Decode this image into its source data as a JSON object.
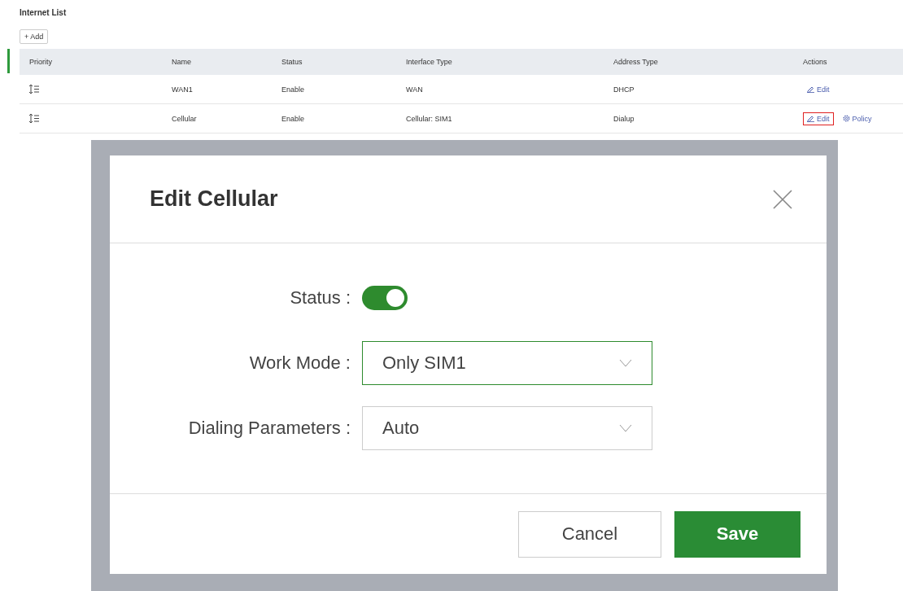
{
  "list": {
    "title": "Internet List",
    "add_button": "+ Add",
    "columns": [
      "Priority",
      "Name",
      "Status",
      "Interface Type",
      "Address Type",
      "Actions"
    ],
    "rows": [
      {
        "name": "WAN1",
        "status": "Enable",
        "interface_type": "WAN",
        "address_type": "DHCP",
        "actions": [
          {
            "kind": "edit",
            "label": "Edit",
            "highlighted": false
          }
        ]
      },
      {
        "name": "Cellular",
        "status": "Enable",
        "interface_type": "Cellular: SIM1",
        "address_type": "Dialup",
        "actions": [
          {
            "kind": "edit",
            "label": "Edit",
            "highlighted": true
          },
          {
            "kind": "policy",
            "label": "Policy",
            "highlighted": false
          }
        ]
      }
    ]
  },
  "dialog": {
    "title": "Edit Cellular",
    "fields": [
      {
        "kind": "switch",
        "label": "Status :",
        "on": true
      },
      {
        "kind": "select",
        "label": "Work Mode :",
        "value": "Only SIM1",
        "focused": true
      },
      {
        "kind": "select",
        "label": "Dialing Parameters :",
        "value": "Auto",
        "focused": false
      }
    ],
    "buttons": [
      {
        "kind": "secondary",
        "label": "Cancel"
      },
      {
        "kind": "primary",
        "label": "Save"
      }
    ]
  }
}
